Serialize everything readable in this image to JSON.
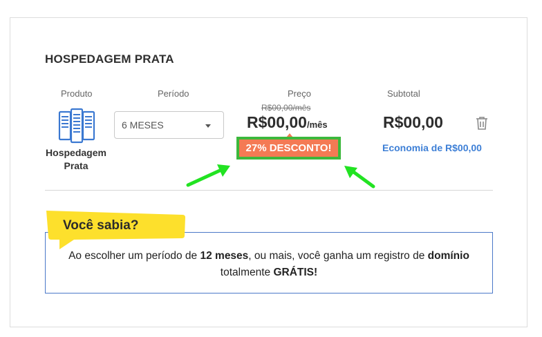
{
  "plan": {
    "title": "HOSPEDAGEM PRATA"
  },
  "columns": {
    "product": "Produto",
    "period": "Período",
    "price": "Preço",
    "subtotal": "Subtotal"
  },
  "product": {
    "name_line1": "Hospedagem",
    "name_line2": "Prata",
    "icon": "server-icon"
  },
  "period": {
    "selected": "6 MESES"
  },
  "price": {
    "old": "R$00,00/mês",
    "current": "R$00,00",
    "unit": "/mês",
    "discount": "27% DESCONTO!"
  },
  "subtotal": {
    "value": "R$00,00",
    "economy": "Economia de R$00,00",
    "delete_icon": "trash-icon"
  },
  "tip": {
    "tag": "Você sabia?",
    "t1": "Ao escolher um período de ",
    "b1": "12 meses",
    "t2": ", ou mais, você ganha um registro de ",
    "b2": "domínio",
    "t3": "totalmente ",
    "b3": "GRÁTIS",
    "t4": "!"
  },
  "colors": {
    "accent_blue": "#3d7fd6",
    "discount": "#f47a54",
    "highlight_green": "#3cb83c",
    "tag_yellow": "#fde02c"
  }
}
